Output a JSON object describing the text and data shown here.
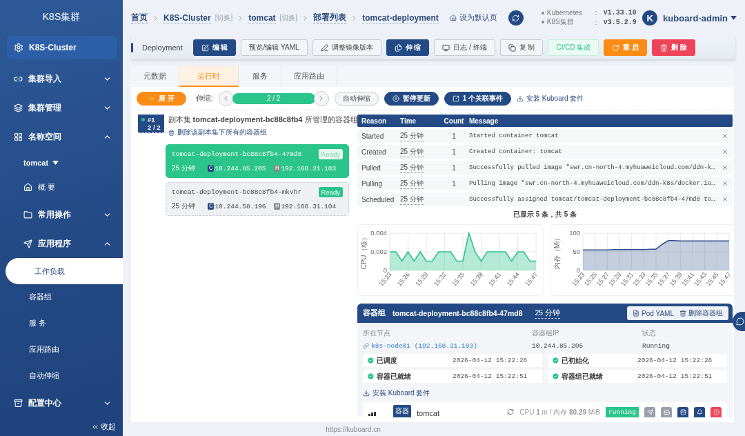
{
  "sidebar": {
    "title": "K8S集群",
    "cluster": "K8S-Cluster",
    "items": [
      {
        "kind": "group",
        "label": "集群导入",
        "expanded": false
      },
      {
        "kind": "group",
        "label": "集群管理",
        "expanded": false
      },
      {
        "kind": "group",
        "label": "名称空间",
        "expanded": true,
        "children": [
          {
            "kind": "namespace",
            "label": "tomcat"
          },
          {
            "kind": "link",
            "label": "概 要",
            "selected": false
          },
          {
            "kind": "group",
            "label": "常用操作",
            "expanded": false
          },
          {
            "kind": "group",
            "label": "应用程序",
            "expanded": true,
            "children": [
              {
                "kind": "link",
                "label": "工作负载",
                "selected": true
              },
              {
                "kind": "link",
                "label": "容器组",
                "selected": false
              },
              {
                "kind": "link",
                "label": "服 务",
                "selected": false
              },
              {
                "kind": "link",
                "label": "应用路由",
                "selected": false
              },
              {
                "kind": "link",
                "label": "自动伸缩",
                "selected": false
              }
            ]
          }
        ]
      },
      {
        "kind": "group",
        "label": "配置中心",
        "expanded": false
      }
    ],
    "collapse": "收起"
  },
  "breadcrumb": [
    {
      "label": "首页"
    },
    {
      "label": "K8S-Cluster",
      "switch": "[切换]"
    },
    {
      "label": "tomcat",
      "switch": "[切换]"
    },
    {
      "label": "部署列表"
    },
    {
      "label": "tomcat-deployment"
    }
  ],
  "set_default": "设为默认页",
  "versions": [
    {
      "name": "Kubernetes",
      "sep": ":",
      "value": "v1.33.10"
    },
    {
      "name": "K8S集群",
      "sep": ":",
      "value": "v3.5.2.9"
    }
  ],
  "user": {
    "initial": "K",
    "name": "kuboard-admin"
  },
  "toolbar": {
    "kind": "Deployment",
    "buttons": [
      {
        "label": "编 辑"
      },
      {
        "label": "预览/编辑 YAML"
      },
      {
        "label": "调整镜像版本"
      },
      {
        "label": "伸 缩"
      },
      {
        "label": "日志 / 终端"
      },
      {
        "label": "复 制"
      },
      {
        "label": "CI/CD 集成"
      },
      {
        "label": "重 启"
      },
      {
        "label": "删 除"
      }
    ]
  },
  "tabs": [
    {
      "label": "元数据",
      "selected": false
    },
    {
      "label": "运行时",
      "selected": true
    },
    {
      "label": "服务",
      "selected": false
    },
    {
      "label": "应用路由",
      "selected": false
    }
  ],
  "controls": {
    "expand": "展 开",
    "scale_label": "伸缩:",
    "replicas": "2 / 2",
    "autoscale": "自动伸缩",
    "pause": "暂停更新",
    "events": "1 个关联事件",
    "install": "安装 Kuboard 套件"
  },
  "replicaset": {
    "index": "#1",
    "ratio": "2 / 2",
    "title": "副本集 **tomcat-deployment-bc88c8fb4** 所管理的容器组",
    "delete": "删除该副本集下所有的容器组",
    "pods": [
      {
        "name": "tomcat-deployment-bc88c8fb4-47md8",
        "status": "Ready",
        "age": "25 分钟",
        "ips": [
          {
            "tag": "C",
            "value": "10.244.85.205"
          },
          {
            "tag": "H",
            "value": "192.168.31.103"
          }
        ],
        "selected": true
      },
      {
        "name": "tomcat-deployment-bc88c8fb4-mkvhr",
        "status": "Ready",
        "age": "25 分钟",
        "ips": [
          {
            "tag": "C",
            "value": "10.244.58.196"
          },
          {
            "tag": "H",
            "value": "192.168.31.104"
          }
        ],
        "selected": false
      }
    ]
  },
  "events": {
    "columns": [
      "Reason",
      "Time",
      "Count",
      "Message"
    ],
    "rows": [
      {
        "reason": "Started",
        "time": "25 分钟",
        "count": "1",
        "message": "Started container tomcat"
      },
      {
        "reason": "Created",
        "time": "25 分钟",
        "count": "1",
        "message": "Created container: tomcat"
      },
      {
        "reason": "Pulled",
        "time": "25 分钟",
        "count": "1",
        "message": "Successfully pulled image \"swr.cn-north-4.myhuaweicloud.com/ddn-k…"
      },
      {
        "reason": "Pulling",
        "time": "25 分钟",
        "count": "1",
        "message": "Pulling image \"swr.cn-north-4.myhuaweicloud.com/ddn-k8s/docker.io…"
      },
      {
        "reason": "Scheduled",
        "time": "25 分钟",
        "message": "Successfully assigned tomcat/tomcat-deployment-bc88c8fb4-47md8 to…"
      }
    ],
    "summary": "已显示 5 条，共 5 条"
  },
  "charts": [
    {
      "chart_data": {
        "type": "area",
        "ylabel": "CPU（核）",
        "categories": [
          "15:23",
          null,
          null,
          "15:26",
          null,
          null,
          "15:29",
          null,
          null,
          "15:32",
          null,
          null,
          "15:35",
          null,
          null,
          "15:38",
          null,
          null,
          "15:41",
          null,
          null,
          "15:44",
          null,
          null,
          "15:47"
        ],
        "series": [
          {
            "color": "#2bc48a",
            "values": [
              0.002,
              0.002,
              0.001,
              0.002,
              0.001,
              0.002,
              0.001,
              0.001,
              0.002,
              0.002,
              0.002,
              0.001,
              0.001,
              0.004,
              0.002,
              0.001,
              0.002,
              0.002,
              0.002,
              0.002,
              0.001,
              0.002,
              0.002,
              0.001,
              0.001
            ]
          }
        ],
        "grid": true,
        "ylim": [
          0,
          0.004
        ],
        "yticks": [
          {
            "value": 0,
            "label": "0"
          },
          {
            "value": 0.002,
            "label": "0.002"
          },
          {
            "value": 0.004,
            "label": "0.004"
          }
        ]
      }
    },
    {
      "chart_data": {
        "type": "area",
        "ylabel": "内存（Mi）",
        "categories": [
          "15:23",
          null,
          "15:25",
          null,
          "15:27",
          null,
          "15:29",
          null,
          "15:31",
          null,
          "15:33",
          null,
          "15:35",
          null,
          "15:37",
          null,
          "15:39",
          null,
          "15:41",
          null,
          "15:43",
          null,
          "15:45",
          null,
          "15:47"
        ],
        "series": [
          {
            "color": "#2f4f8a",
            "values": [
              55,
              55,
              55,
              55,
              55,
              56,
              56,
              56,
              56,
              56,
              56,
              57,
              57,
              70,
              80,
              80,
              79,
              79,
              79,
              79,
              79,
              79,
              79,
              79,
              79
            ]
          }
        ],
        "grid": true,
        "ylim": [
          0,
          100
        ],
        "yticks": [
          {
            "value": 0,
            "label": "0"
          },
          {
            "value": 50,
            "label": "50"
          },
          {
            "value": 100,
            "label": "100"
          }
        ]
      }
    }
  ],
  "pod_detail": {
    "label": "容器组",
    "name": "tomcat-deployment-bc88c8fb4-47md8",
    "age": "25 分钟",
    "buttons": [
      "Pod YAML",
      "删除容器组"
    ],
    "fields": [
      {
        "label": "所在节点",
        "value": "k8s-node01 (192.168.31.103)",
        "kind": "link"
      },
      {
        "label": "容器组IP",
        "value": "10.244.85.205",
        "kind": "text"
      },
      {
        "label": "状态",
        "value": "Running",
        "kind": "text"
      }
    ],
    "conditions": [
      {
        "label": "已调度",
        "time": "2026-04-12 15:22:28",
        "ok": true
      },
      {
        "label": "已初始化",
        "time": "2026-04-12 15:22:28",
        "ok": true
      },
      {
        "label": "容器已就绪",
        "time": "2026-04-12 15:22:51",
        "ok": true
      },
      {
        "label": "容器组已就绪",
        "time": "2026-04-12 15:22:51",
        "ok": true
      }
    ],
    "install": "安装 Kuboard 套件",
    "container": {
      "tag": "容器",
      "name": "tomcat",
      "usage": "CPU **1** m / 内存 **80.29** MiB",
      "status": "running"
    }
  },
  "status_url": "https://kuboard.cn"
}
